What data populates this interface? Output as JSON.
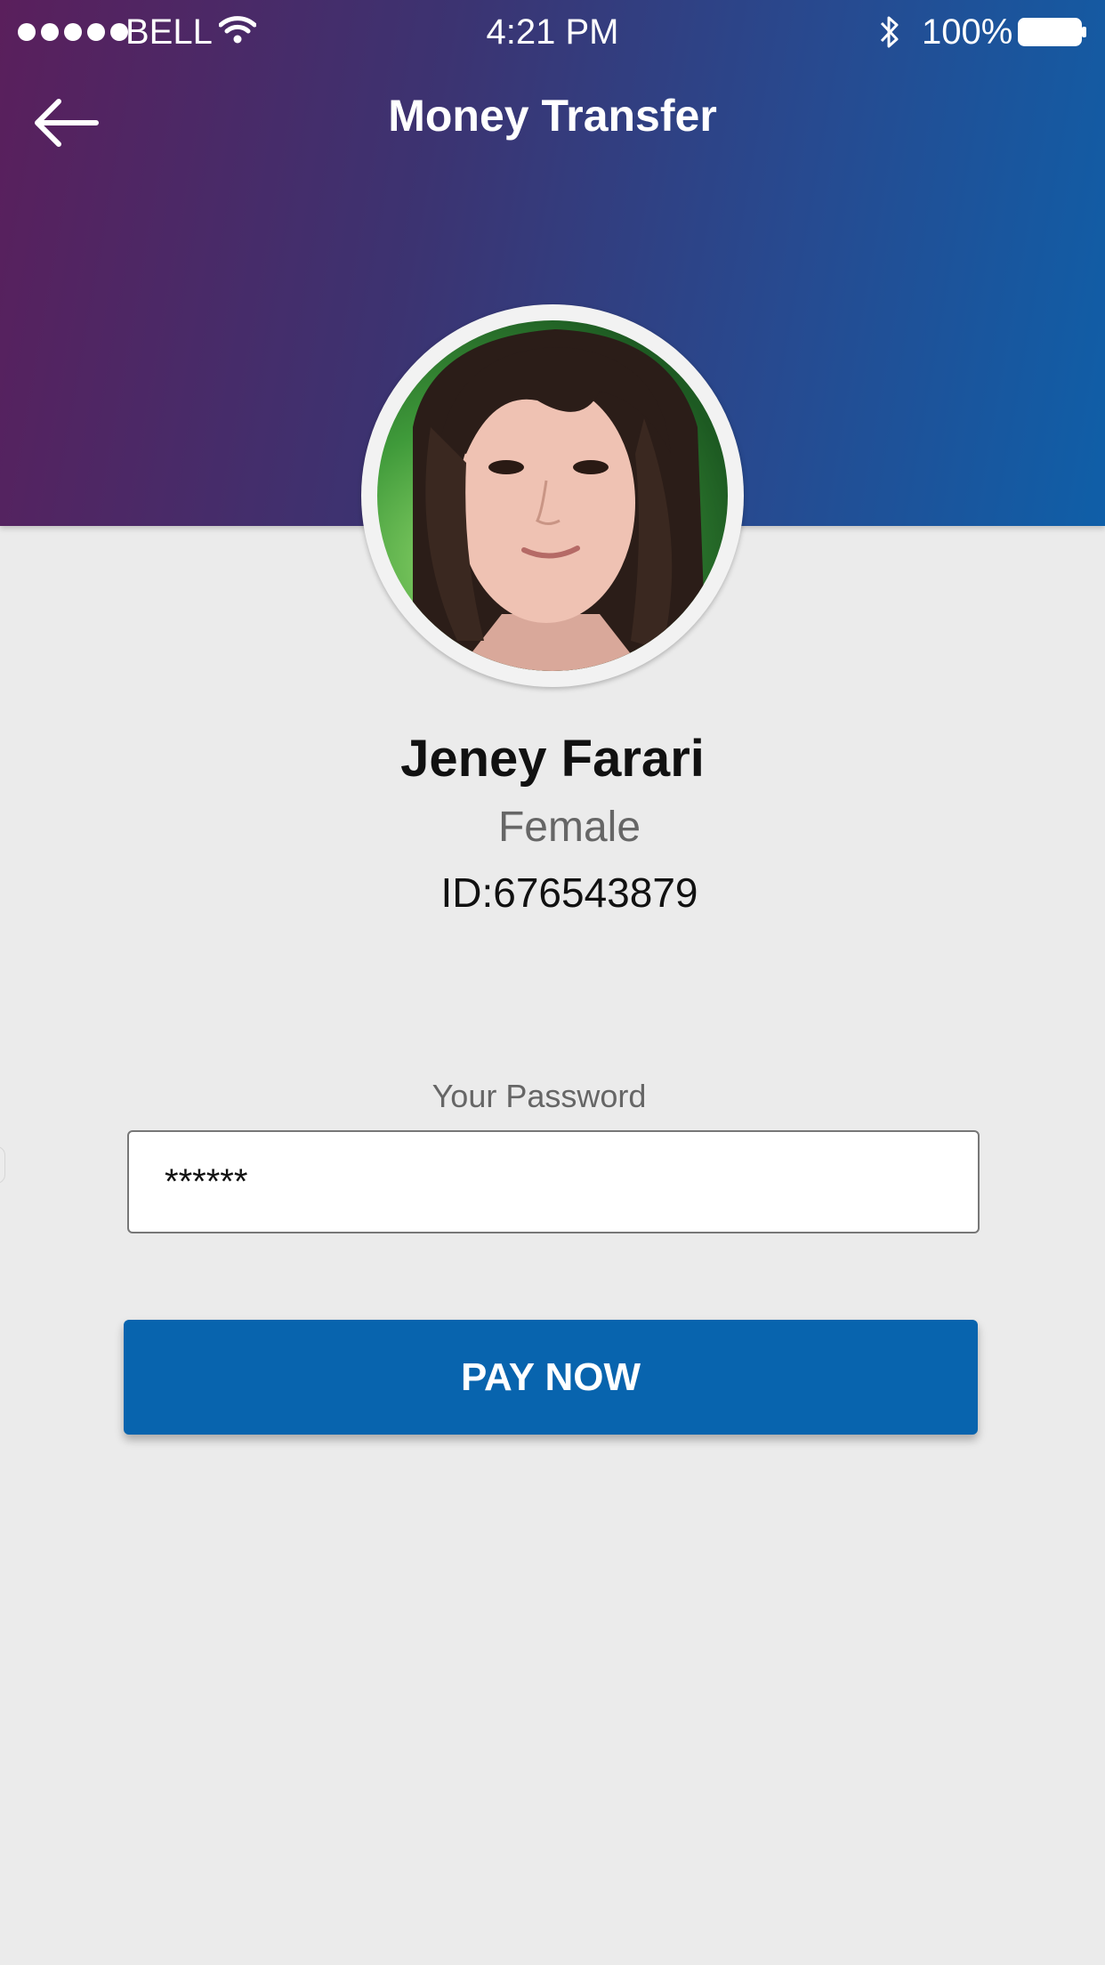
{
  "status_bar": {
    "carrier": "BELL",
    "time": "4:21 PM",
    "battery_percent": "100%",
    "icons": [
      "signal-dots-icon",
      "wifi-icon",
      "bluetooth-icon",
      "battery-icon"
    ]
  },
  "nav": {
    "title": "Money Transfer",
    "back_icon": "arrow-left-icon"
  },
  "profile": {
    "name": "Jeney Farari",
    "gender": "Female",
    "id": "ID:676543879"
  },
  "password": {
    "label": "Your Password",
    "value": "******"
  },
  "actions": {
    "pay_label": "PAY NOW"
  },
  "colors": {
    "header_gradient_start": "#5a1f5c",
    "header_gradient_end": "#0f5fa8",
    "button": "#0864ae",
    "background": "#ebebeb"
  }
}
